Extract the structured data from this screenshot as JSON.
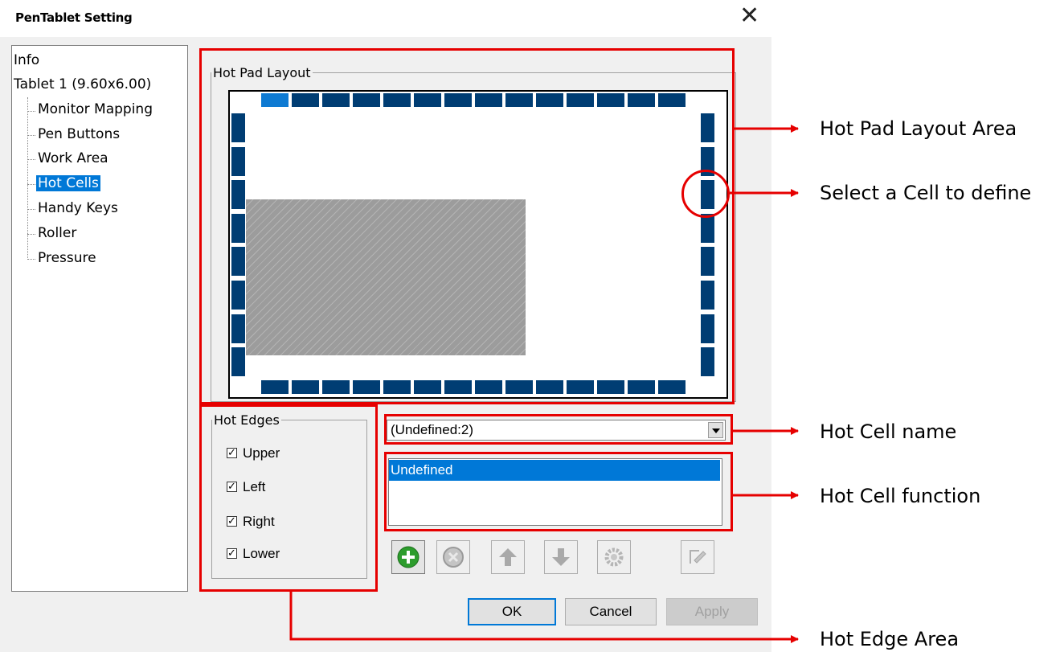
{
  "window": {
    "title": "PenTablet Setting",
    "close_glyph": "✕"
  },
  "tree": {
    "items": [
      {
        "label": "Info"
      },
      {
        "label": "Tablet  1 (9.60x6.00)"
      },
      {
        "label": "Monitor Mapping"
      },
      {
        "label": "Pen Buttons"
      },
      {
        "label": "Work Area"
      },
      {
        "label": "Hot Cells",
        "selected": true
      },
      {
        "label": "Handy Keys"
      },
      {
        "label": "Roller"
      },
      {
        "label": "Pressure"
      }
    ]
  },
  "layout_group": {
    "label": "Hot Pad Layout"
  },
  "hot_pad": {
    "cells_per_horizontal_edge": 14,
    "cells_per_vertical_edge": 8,
    "selected_cell": "upper-1",
    "cell_color": "#003d73",
    "selected_cell_color": "#0e7ad2"
  },
  "edges_group": {
    "label": "Hot Edges",
    "items": [
      {
        "label": "Upper",
        "checked": true
      },
      {
        "label": "Left",
        "checked": true
      },
      {
        "label": "Right",
        "checked": true
      },
      {
        "label": "Lower",
        "checked": true
      }
    ],
    "check_glyph": "✓"
  },
  "cell_name": {
    "value": "(Undefined:2)"
  },
  "cell_function": {
    "items": [
      "Undefined"
    ],
    "selected": "Undefined"
  },
  "toolbar": {
    "icons": [
      "add-icon",
      "delete-icon",
      "move-up-icon",
      "move-down-icon",
      "settings-icon",
      "edit-icon"
    ]
  },
  "buttons": {
    "ok": "OK",
    "cancel": "Cancel",
    "apply": "Apply"
  },
  "annotations": {
    "layout_area": "Hot Pad Layout Area",
    "select_cell": "Select a Cell to define",
    "cell_name": "Hot Cell name",
    "cell_function": "Hot Cell function",
    "edge_area": "Hot Edge Area"
  },
  "colors": {
    "annotation": "#e60000",
    "selection": "#0078d7"
  }
}
